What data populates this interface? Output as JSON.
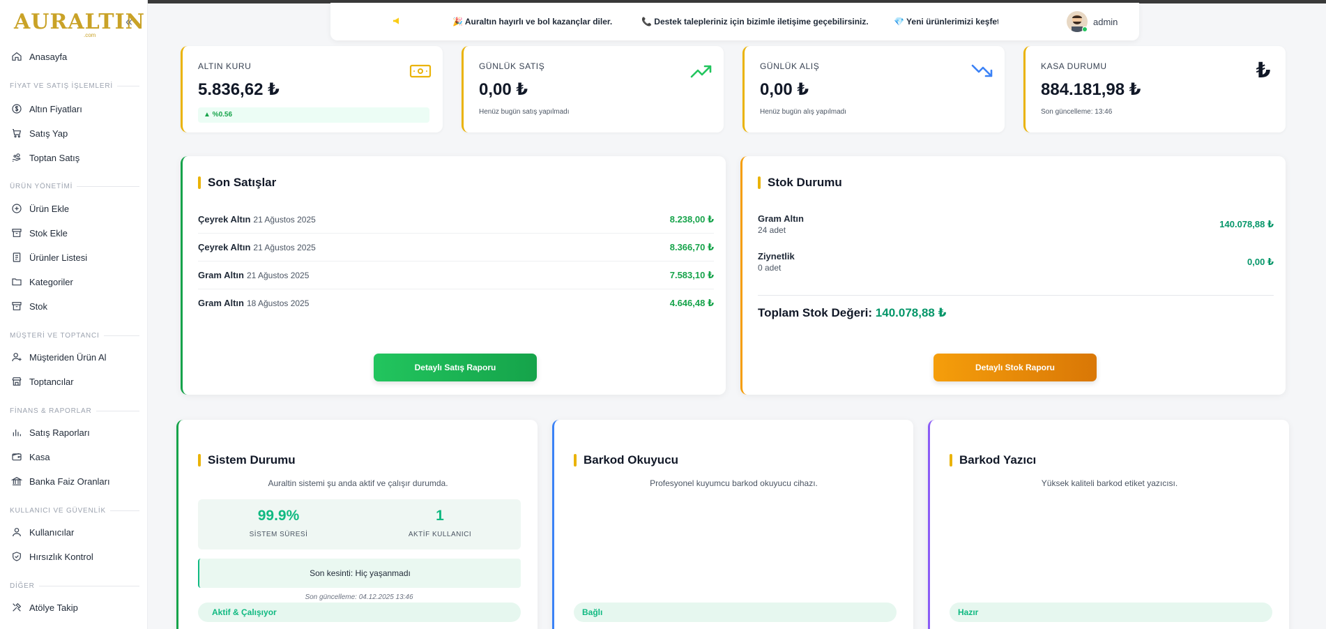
{
  "brand": {
    "logo_text": "AURALTIN",
    "logo_sub": ".com"
  },
  "sidebar": {
    "home": "Anasayfa",
    "sections": [
      {
        "title": "FİYAT VE SATIŞ İŞLEMLERİ",
        "items": [
          "Altın Fiyatları",
          "Satış Yap",
          "Toptan Satış"
        ]
      },
      {
        "title": "ÜRÜN YÖNETİMİ",
        "items": [
          "Ürün Ekle",
          "Stok Ekle",
          "Ürünler Listesi",
          "Kategoriler",
          "Stok"
        ]
      },
      {
        "title": "MÜŞTERİ VE TOPTANCI",
        "items": [
          "Müşteriden Ürün Al",
          "Toptancılar"
        ]
      },
      {
        "title": "FİNANS & RAPORLAR",
        "items": [
          "Satış Raporları",
          "Kasa",
          "Banka Faiz Oranları"
        ]
      },
      {
        "title": "KULLANICI VE GÜVENLİK",
        "items": [
          "Kullanıcılar",
          "Hırsızlık Kontrol"
        ]
      },
      {
        "title": "DİĞER",
        "items": [
          "Atölye Takip"
        ]
      }
    ]
  },
  "announcements": [
    "🎉 Auraltın hayırlı ve bol kazançlar diler.",
    "📞 Destek talepleriniz için bizimle iletişime geçebilirsiniz.",
    "💎 Yeni ürünlerimizi keşfet"
  ],
  "user": {
    "name": "admin"
  },
  "stats": [
    {
      "label": "ALTIN KURU",
      "value": "5.836,62 ₺",
      "change": "▲ %0.56"
    },
    {
      "label": "GÜNLÜK SATIŞ",
      "value": "0,00 ₺",
      "sub": "Henüz bugün satış yapılmadı"
    },
    {
      "label": "GÜNLÜK ALIŞ",
      "value": "0,00 ₺",
      "sub": "Henüz bugün alış yapılmadı"
    },
    {
      "label": "KASA DURUMU",
      "value": "884.181,98 ₺",
      "sub": "Son güncelleme: 13:46"
    }
  ],
  "recent_sales": {
    "title": "Son Satışlar",
    "rows": [
      {
        "name": "Çeyrek Altın",
        "date": "21 Ağustos 2025",
        "price": "8.238,00 ₺"
      },
      {
        "name": "Çeyrek Altın",
        "date": "21 Ağustos 2025",
        "price": "8.366,70 ₺"
      },
      {
        "name": "Gram Altın",
        "date": "21 Ağustos 2025",
        "price": "7.583,10 ₺"
      },
      {
        "name": "Gram Altın",
        "date": "18 Ağustos 2025",
        "price": "4.646,48 ₺"
      }
    ],
    "button": "Detaylı Satış Raporu"
  },
  "stock": {
    "title": "Stok Durumu",
    "rows": [
      {
        "name": "Gram Altın",
        "qty": "24 adet",
        "price": "140.078,88 ₺"
      },
      {
        "name": "Ziynetlik",
        "qty": "0 adet",
        "price": "0,00 ₺"
      }
    ],
    "total_label": "Toplam Stok Değeri:",
    "total_value": "140.078,88 ₺",
    "button": "Detaylı Stok Raporu"
  },
  "system": {
    "title": "Sistem Durumu",
    "desc": "Auraltin sistemi şu anda aktif ve çalışır durumda.",
    "uptime_value": "99.9%",
    "uptime_label": "SİSTEM SÜRESİ",
    "users_value": "1",
    "users_label": "AKTİF KULLANICI",
    "outage": "Son kesinti: Hiç yaşanmadı",
    "updated": "Son güncelleme: 04.12.2025 13:46",
    "status": "Aktif & Çalışıyor"
  },
  "scanner": {
    "title": "Barkod Okuyucu",
    "desc": "Profesyonel kuyumcu barkod okuyucu cihazı.",
    "status": "Bağlı"
  },
  "printer": {
    "title": "Barkod Yazıcı",
    "desc": "Yüksek kaliteli barkod etiket yazıcısı.",
    "status": "Hazır"
  },
  "colors": {
    "gold": "#eab308",
    "green": "#16a34a",
    "orange": "#f59e0b",
    "blue": "#3b82f6",
    "purple": "#8b5cf6"
  }
}
